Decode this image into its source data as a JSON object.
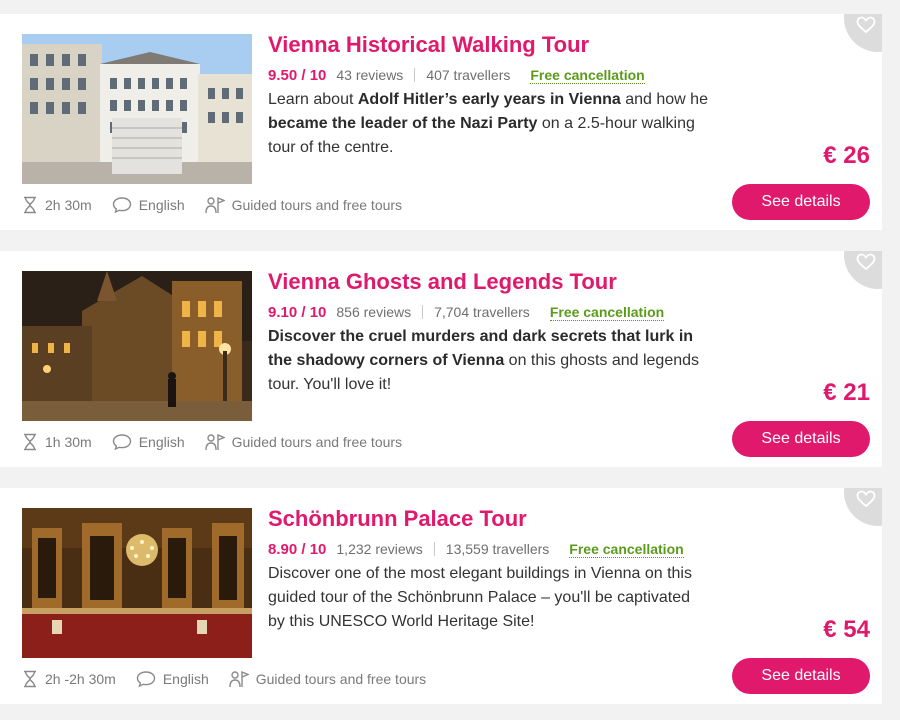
{
  "tours": [
    {
      "title": "Vienna Historical Walking Tour",
      "score": "9.50 / 10",
      "reviews": "43 reviews",
      "travellers": "407 travellers",
      "free_cancellation": "Free cancellation",
      "desc": {
        "p1": "Learn about ",
        "b1": "Adolf Hitler’s early years in Vienna",
        "p2": " and how he ",
        "b2": "became the leader of the Nazi Party",
        "p3": " on a 2.5-hour walking tour of the centre."
      },
      "price": "€ 26",
      "button": "See details",
      "duration": "2h 30m",
      "language": "English",
      "category": "Guided tours and free tours",
      "image_icon": "city-square-photo"
    },
    {
      "title": "Vienna Ghosts and Legends Tour",
      "score": "9.10 / 10",
      "reviews": "856 reviews",
      "travellers": "7,704 travellers",
      "free_cancellation": "Free cancellation",
      "desc": {
        "b1": "Discover the cruel murders and dark secrets that lurk in the shadowy corners of Vienna",
        "p1": " on this ghosts and legends tour. You'll love it!"
      },
      "price": "€ 21",
      "button": "See details",
      "duration": "1h 30m",
      "language": "English",
      "category": "Guided tours and free tours",
      "image_icon": "night-cathedral-photo"
    },
    {
      "title": "Schönbrunn Palace Tour",
      "score": "8.90 / 10",
      "reviews": "1,232 reviews",
      "travellers": "13,559 travellers",
      "free_cancellation": "Free cancellation",
      "desc": {
        "p1": "Discover one of the most elegant buildings in Vienna on this guided tour of the Schönbrunn Palace – you'll be captivated by this UNESCO World Heritage Site!"
      },
      "price": "€ 54",
      "button": "See details",
      "duration": "2h -2h 30m",
      "language": "English",
      "category": "Guided tours and free tours",
      "image_icon": "palace-interior-photo"
    }
  ],
  "colors": {
    "accent": "#e0196d",
    "green": "#5a9c1a",
    "muted": "#6f6f6f",
    "bg": "#f2f2f2"
  }
}
